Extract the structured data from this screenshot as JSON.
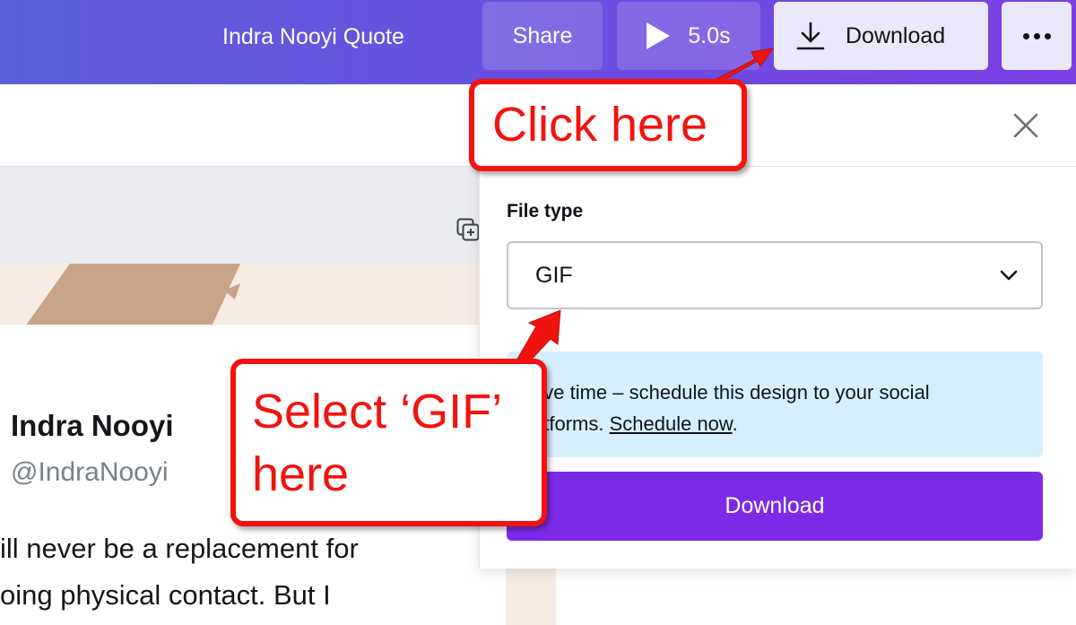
{
  "header": {
    "design_title": "Indra Nooyi Quote",
    "share_label": "Share",
    "duration_label": "5.0s",
    "download_label": "Download"
  },
  "canvas": {
    "author_name": "Indra Nooyi",
    "author_handle": "@IndraNooyi",
    "quote_line_1": "ill never be a replacement for",
    "quote_line_2": "oing physical contact. But I"
  },
  "download_panel": {
    "file_type_label": "File type",
    "file_type_value": "GIF",
    "schedule_text": "ave time – schedule this design to your social\natforms.",
    "schedule_link": "Schedule now",
    "schedule_suffix": ".",
    "download_button": "Download"
  },
  "annotations": {
    "click_here": "Click here",
    "select_gif_line1": "Select ‘GIF’",
    "select_gif_line2": "here"
  },
  "colors": {
    "accent_purple": "#7d2ae8",
    "annotation_red": "#f2130f",
    "schedule_bg": "#d6efff"
  },
  "icons": [
    "play-icon",
    "download-icon",
    "more-icon",
    "close-icon",
    "chevron-down-icon",
    "copy-icon"
  ]
}
